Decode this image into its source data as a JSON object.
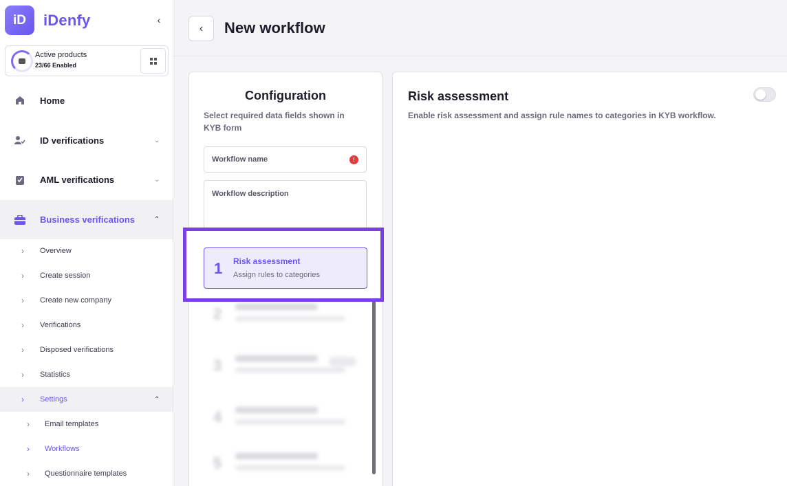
{
  "brand": {
    "logo_mark": "iD",
    "name": "iDenfy"
  },
  "products": {
    "title": "Active products",
    "subtitle": "23/66 Enabled"
  },
  "sidebar": {
    "items": [
      {
        "label": "Home",
        "icon": "home-icon"
      },
      {
        "label": "ID verifications",
        "icon": "user-check-icon"
      },
      {
        "label": "AML verifications",
        "icon": "clipboard-check-icon"
      },
      {
        "label": "Business verifications",
        "icon": "briefcase-icon"
      }
    ],
    "business_sub": [
      "Overview",
      "Create session",
      "Create new company",
      "Verifications",
      "Disposed verifications",
      "Statistics",
      "Settings"
    ],
    "settings_sub": [
      "Email templates",
      "Workflows",
      "Questionnaire templates"
    ]
  },
  "header": {
    "title": "New workflow"
  },
  "config": {
    "title": "Configuration",
    "description": "Select required data fields shown in KYB form",
    "workflow_name_placeholder": "Workflow name",
    "workflow_description_placeholder": "Workflow description",
    "required_marker": "!",
    "active_step": {
      "number": "1",
      "title": "Risk assessment",
      "subtitle": "Assign rules to categories"
    }
  },
  "risk": {
    "title": "Risk assessment",
    "description": "Enable risk assessment and assign rule names to categories in KYB workflow.",
    "toggle_on": false
  },
  "colors": {
    "accent": "#6a56ee",
    "highlight": "#7b3fe8",
    "required": "#e5393c"
  }
}
